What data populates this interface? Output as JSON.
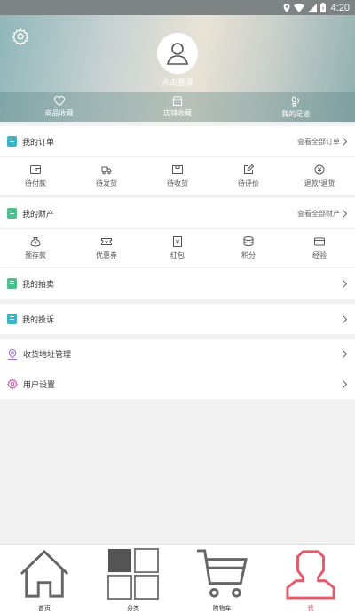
{
  "status_bar": {
    "time": "4:20"
  },
  "profile": {
    "login_text": "点击登录"
  },
  "favorites": [
    {
      "label": "商品收藏"
    },
    {
      "label": "店铺收藏"
    },
    {
      "label": "我的足迹"
    }
  ],
  "orders": {
    "title": "我的订单",
    "more": "查看全部订单",
    "items": [
      {
        "label": "待付款"
      },
      {
        "label": "待发货"
      },
      {
        "label": "待收货"
      },
      {
        "label": "待评价"
      },
      {
        "label": "退款/退货"
      }
    ]
  },
  "assets": {
    "title": "我的财产",
    "more": "查看全部财产",
    "items": [
      {
        "label": "预存款"
      },
      {
        "label": "优惠券"
      },
      {
        "label": "红包"
      },
      {
        "label": "积分"
      },
      {
        "label": "经验"
      }
    ]
  },
  "auction": {
    "title": "我的拍卖"
  },
  "complaint": {
    "title": "我的投诉"
  },
  "address": {
    "title": "收货地址管理"
  },
  "user_settings": {
    "title": "用户设置"
  },
  "tabs": [
    {
      "label": "首页"
    },
    {
      "label": "分类"
    },
    {
      "label": "购物车"
    },
    {
      "label": "我"
    }
  ],
  "colors": {
    "accent": "#e35a6a",
    "teal": "#3fb3c6",
    "green": "#4cc08a",
    "purple": "#9a6bd0",
    "pink": "#d45aa8"
  }
}
